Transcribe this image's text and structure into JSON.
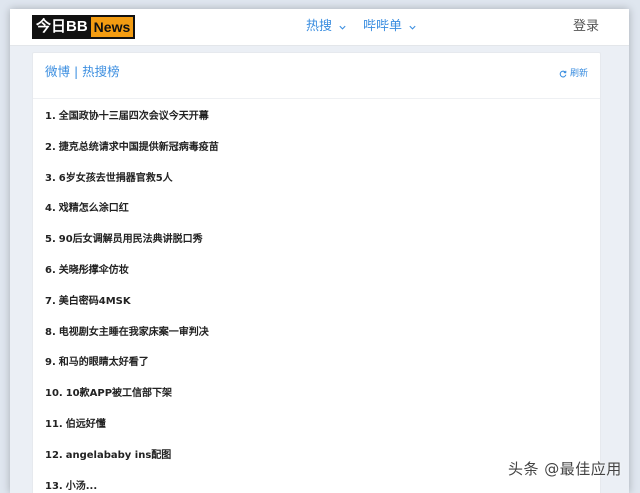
{
  "header": {
    "logo_main": "今日BB",
    "logo_news": "News",
    "nav": [
      {
        "label": "热搜"
      },
      {
        "label": "哔哔单"
      }
    ],
    "login_label": "登录"
  },
  "card": {
    "title": "微博 | 热搜榜",
    "refresh_label": "刷新"
  },
  "hot_list": [
    {
      "rank": "1.",
      "text": "全国政协十三届四次会议今天开幕"
    },
    {
      "rank": "2.",
      "text": "捷克总统请求中国提供新冠病毒疫苗"
    },
    {
      "rank": "3.",
      "text": "6岁女孩去世捐器官救5人"
    },
    {
      "rank": "4.",
      "text": "戏精怎么涂口红"
    },
    {
      "rank": "5.",
      "text": "90后女调解员用民法典讲脱口秀"
    },
    {
      "rank": "6.",
      "text": "关晓彤撑伞仿妆"
    },
    {
      "rank": "7.",
      "text": "美白密码4MSK"
    },
    {
      "rank": "8.",
      "text": "电视剧女主睡在我家床案一审判决"
    },
    {
      "rank": "9.",
      "text": "和马的眼睛太好看了"
    },
    {
      "rank": "10.",
      "text": "10款APP被工信部下架"
    },
    {
      "rank": "11.",
      "text": "伯远好懂"
    },
    {
      "rank": "12.",
      "text": "angelababy ins配图"
    },
    {
      "rank": "13.",
      "text": "小汤..."
    }
  ],
  "watermark": "头条 @最佳应用",
  "colors": {
    "accent": "#3b8ee0",
    "logo_orange": "#f39c12",
    "page_bg": "#ebeff5"
  },
  "icons": {
    "nav_chevron": "chevron-down-icon",
    "refresh": "refresh-icon"
  }
}
